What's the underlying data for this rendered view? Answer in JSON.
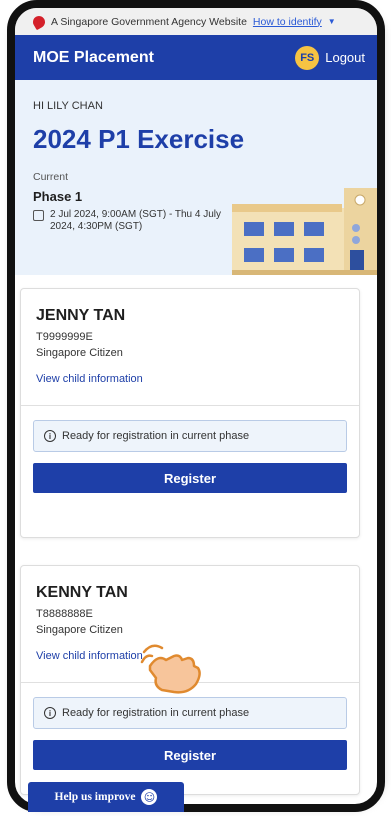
{
  "masthead": {
    "text": "A Singapore Government Agency Website",
    "link": "How to identify",
    "chevron": "chevron-down-icon"
  },
  "navbar": {
    "brand": "MOE Placement",
    "avatar_initials": "FS",
    "logout": "Logout"
  },
  "hero": {
    "greeting": "HI LILY CHAN",
    "title": "2024 P1 Exercise",
    "current_label": "Current",
    "phase": "Phase 1",
    "dates": "2 Jul 2024, 9:00AM (SGT) - Thu 4 July 2024, 4:30PM (SGT)"
  },
  "children": [
    {
      "name": "JENNY TAN",
      "id": "T9999999E",
      "status": "Singapore Citizen",
      "view_link": "View child information",
      "notice": "Ready for registration in current phase",
      "register": "Register"
    },
    {
      "name": "KENNY TAN",
      "id": "T8888888E",
      "status": "Singapore Citizen",
      "view_link": "View child information",
      "notice": "Ready for registration in current phase",
      "register": "Register"
    }
  ],
  "help": {
    "label": "Help us improve",
    "icon": "smiley-icon"
  },
  "colors": {
    "primary": "#1e3fa8",
    "hero_bg": "#eaf2fb",
    "avatar": "#f6c343",
    "brand_red": "#d4202a"
  }
}
